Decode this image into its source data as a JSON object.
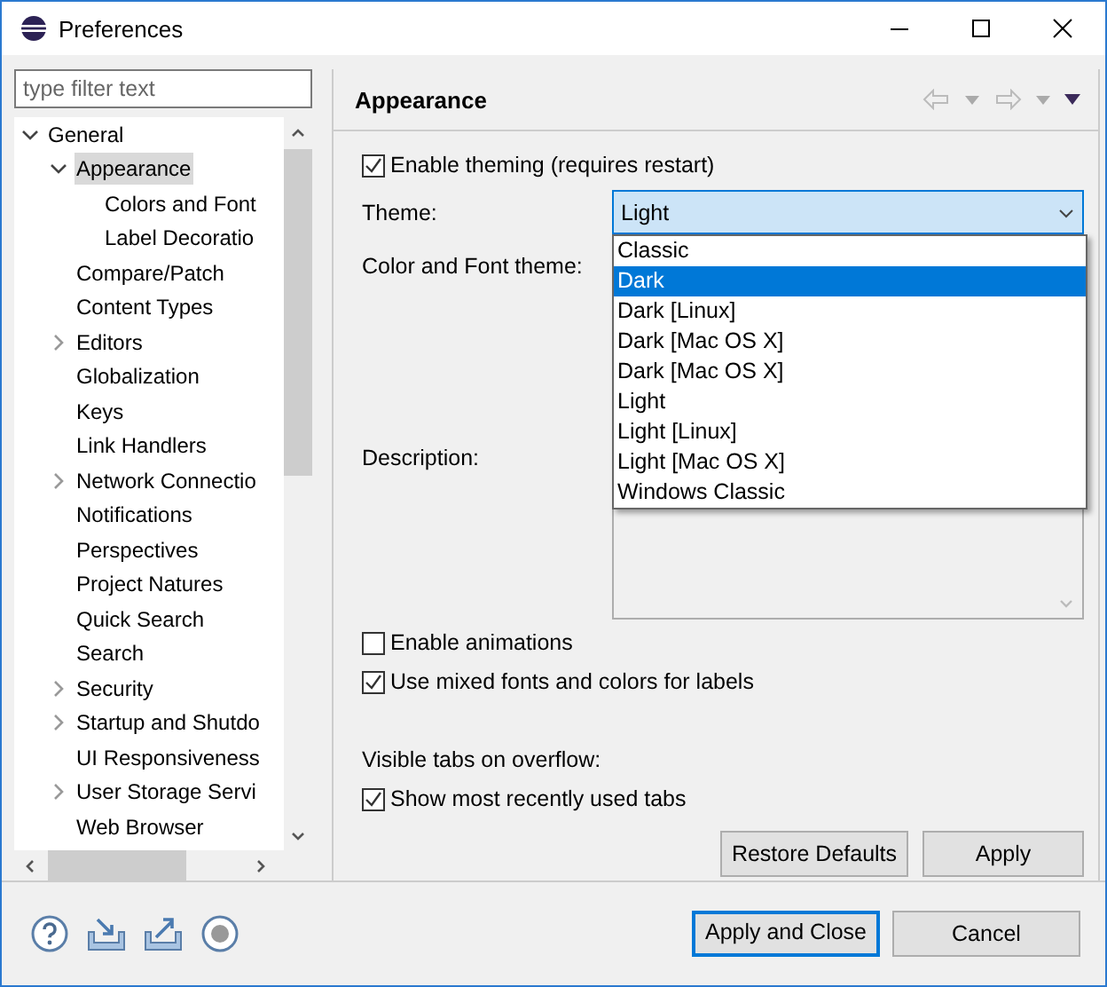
{
  "window": {
    "title": "Preferences"
  },
  "filter": {
    "placeholder": "type filter text"
  },
  "tree": [
    {
      "label": "General",
      "expanded": true,
      "selected": false,
      "children": [
        {
          "label": "Appearance",
          "expanded": true,
          "selected": true,
          "children": [
            {
              "label": "Colors and Font",
              "selected": false
            },
            {
              "label": "Label Decoratio",
              "selected": false
            }
          ]
        },
        {
          "label": "Compare/Patch",
          "selected": false
        },
        {
          "label": "Content Types",
          "selected": false
        },
        {
          "label": "Editors",
          "expanded": false,
          "selected": false
        },
        {
          "label": "Globalization",
          "selected": false
        },
        {
          "label": "Keys",
          "selected": false
        },
        {
          "label": "Link Handlers",
          "selected": false
        },
        {
          "label": "Network Connectio",
          "expanded": false,
          "selected": false
        },
        {
          "label": "Notifications",
          "selected": false
        },
        {
          "label": "Perspectives",
          "selected": false
        },
        {
          "label": "Project Natures",
          "selected": false
        },
        {
          "label": "Quick Search",
          "selected": false
        },
        {
          "label": "Search",
          "selected": false
        },
        {
          "label": "Security",
          "expanded": false,
          "selected": false
        },
        {
          "label": "Startup and Shutdo",
          "expanded": false,
          "selected": false
        },
        {
          "label": "UI Responsiveness",
          "selected": false
        },
        {
          "label": "User Storage Servi",
          "expanded": false,
          "selected": false
        },
        {
          "label": "Web Browser",
          "selected": false
        }
      ]
    }
  ],
  "page": {
    "title": "Appearance"
  },
  "enable_theming": {
    "label": "Enable theming (requires restart)",
    "checked": true
  },
  "theme": {
    "label": "Theme:",
    "value": "Light",
    "options": [
      {
        "label": "Classic",
        "highlighted": false
      },
      {
        "label": "Dark",
        "highlighted": true
      },
      {
        "label": "Dark [Linux]",
        "highlighted": false
      },
      {
        "label": "Dark [Mac OS X]",
        "highlighted": false
      },
      {
        "label": "Dark [Mac OS X]",
        "highlighted": false
      },
      {
        "label": "Light",
        "highlighted": false
      },
      {
        "label": "Light [Linux]",
        "highlighted": false
      },
      {
        "label": "Light [Mac OS X]",
        "highlighted": false
      },
      {
        "label": "Windows Classic",
        "highlighted": false
      }
    ]
  },
  "color_font_theme": {
    "label": "Color and Font theme:"
  },
  "description": {
    "label": "Description:"
  },
  "options": [
    {
      "label": "Enable animations",
      "checked": false
    },
    {
      "label": "Use mixed fonts and colors for labels",
      "checked": true
    }
  ],
  "visible_tabs": {
    "label": "Visible tabs on overflow:",
    "option": {
      "label": "Show most recently used tabs",
      "checked": true
    }
  },
  "page_buttons": [
    "Restore Defaults",
    "Apply"
  ],
  "dialog_buttons": [
    {
      "label": "Apply and Close",
      "default": true
    },
    {
      "label": "Cancel",
      "default": false
    }
  ]
}
